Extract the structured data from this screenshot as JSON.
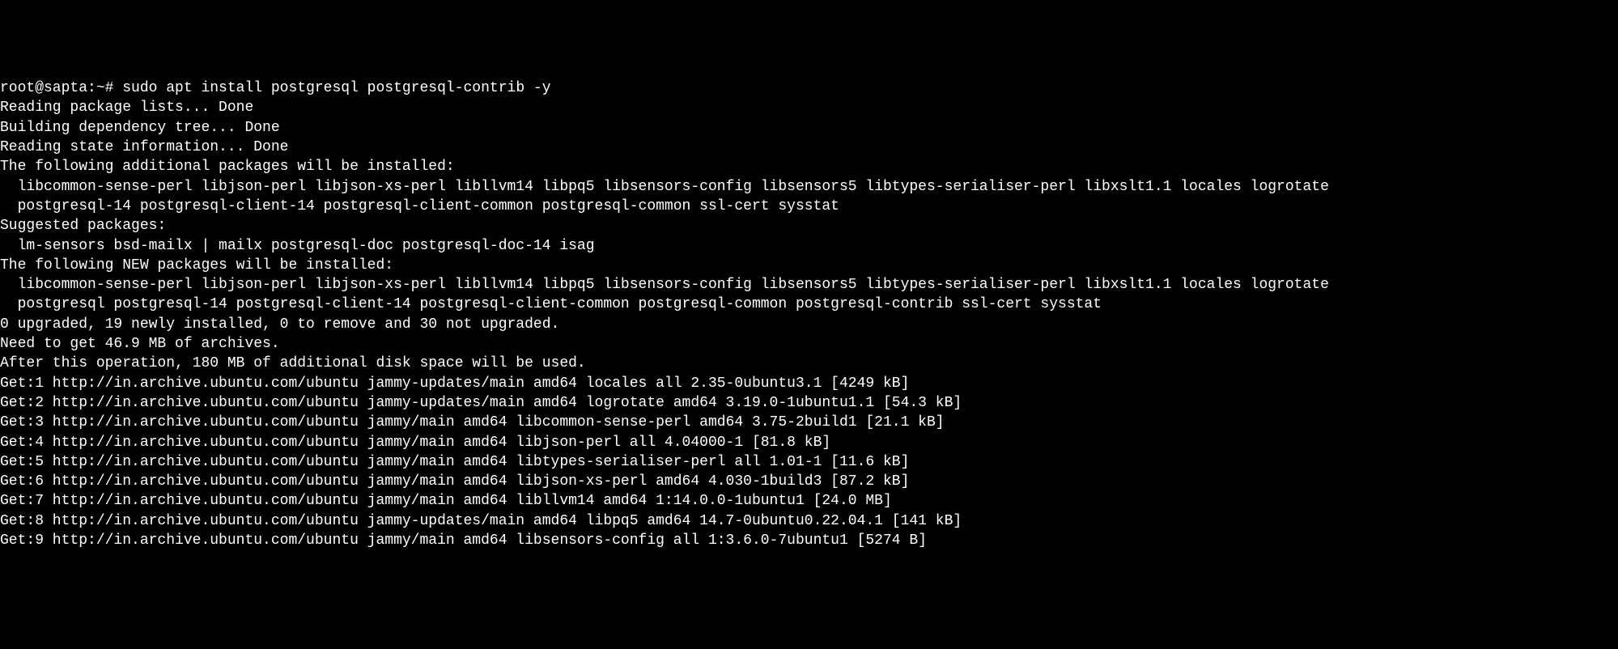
{
  "prompt": "root@sapta:~# ",
  "command": "sudo apt install postgresql postgresql-contrib -y",
  "lines": [
    "Reading package lists... Done",
    "Building dependency tree... Done",
    "Reading state information... Done",
    "The following additional packages will be installed:",
    "  libcommon-sense-perl libjson-perl libjson-xs-perl libllvm14 libpq5 libsensors-config libsensors5 libtypes-serialiser-perl libxslt1.1 locales logrotate",
    "  postgresql-14 postgresql-client-14 postgresql-client-common postgresql-common ssl-cert sysstat",
    "Suggested packages:",
    "  lm-sensors bsd-mailx | mailx postgresql-doc postgresql-doc-14 isag",
    "The following NEW packages will be installed:",
    "  libcommon-sense-perl libjson-perl libjson-xs-perl libllvm14 libpq5 libsensors-config libsensors5 libtypes-serialiser-perl libxslt1.1 locales logrotate",
    "  postgresql postgresql-14 postgresql-client-14 postgresql-client-common postgresql-common postgresql-contrib ssl-cert sysstat",
    "0 upgraded, 19 newly installed, 0 to remove and 30 not upgraded.",
    "Need to get 46.9 MB of archives.",
    "After this operation, 180 MB of additional disk space will be used.",
    "Get:1 http://in.archive.ubuntu.com/ubuntu jammy-updates/main amd64 locales all 2.35-0ubuntu3.1 [4249 kB]",
    "Get:2 http://in.archive.ubuntu.com/ubuntu jammy-updates/main amd64 logrotate amd64 3.19.0-1ubuntu1.1 [54.3 kB]",
    "Get:3 http://in.archive.ubuntu.com/ubuntu jammy/main amd64 libcommon-sense-perl amd64 3.75-2build1 [21.1 kB]",
    "Get:4 http://in.archive.ubuntu.com/ubuntu jammy/main amd64 libjson-perl all 4.04000-1 [81.8 kB]",
    "Get:5 http://in.archive.ubuntu.com/ubuntu jammy/main amd64 libtypes-serialiser-perl all 1.01-1 [11.6 kB]",
    "Get:6 http://in.archive.ubuntu.com/ubuntu jammy/main amd64 libjson-xs-perl amd64 4.030-1build3 [87.2 kB]",
    "Get:7 http://in.archive.ubuntu.com/ubuntu jammy/main amd64 libllvm14 amd64 1:14.0.0-1ubuntu1 [24.0 MB]",
    "Get:8 http://in.archive.ubuntu.com/ubuntu jammy-updates/main amd64 libpq5 amd64 14.7-0ubuntu0.22.04.1 [141 kB]",
    "Get:9 http://in.archive.ubuntu.com/ubuntu jammy/main amd64 libsensors-config all 1:3.6.0-7ubuntu1 [5274 B]"
  ]
}
